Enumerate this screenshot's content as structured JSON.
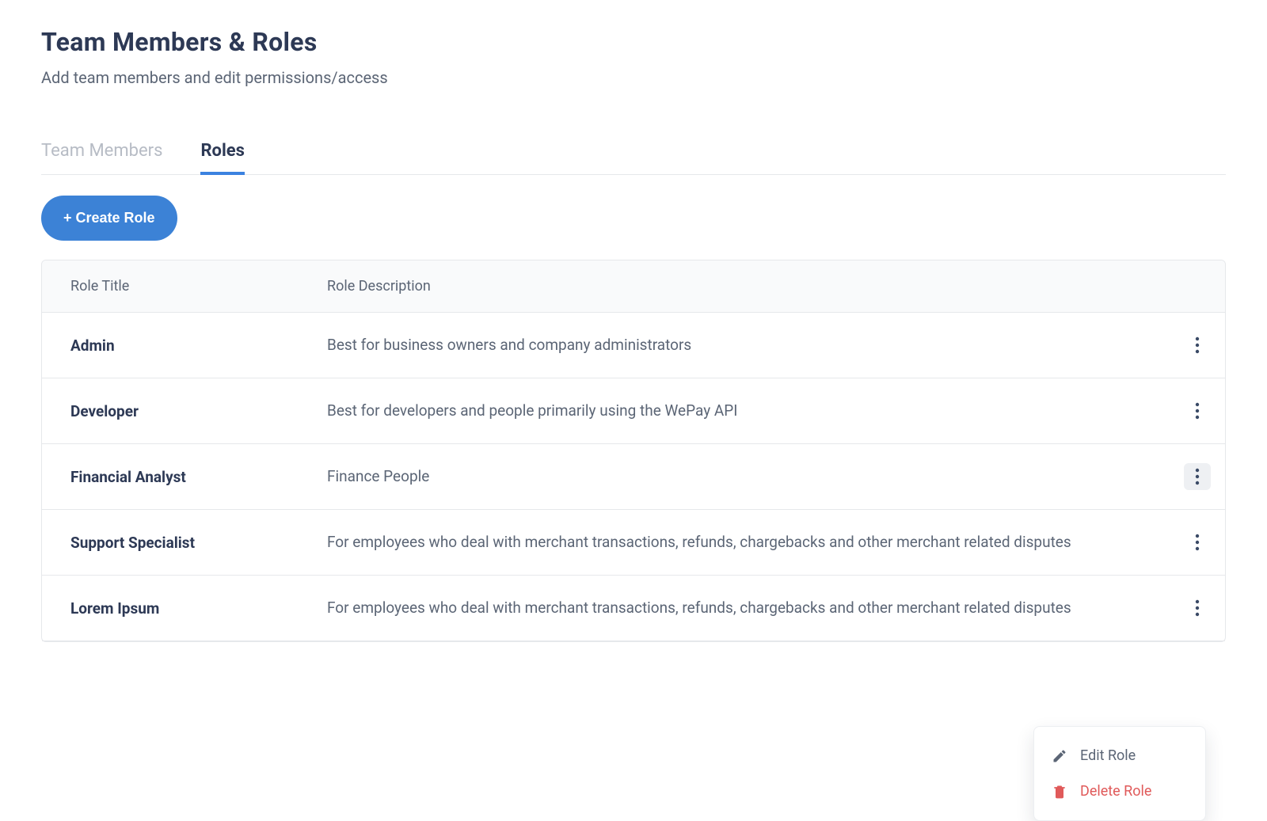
{
  "header": {
    "title": "Team Members & Roles",
    "subtitle": "Add team members and edit permissions/access"
  },
  "tabs": [
    {
      "label": "Team Members",
      "active": false
    },
    {
      "label": "Roles",
      "active": true
    }
  ],
  "actions": {
    "create_label": "+ Create Role"
  },
  "table": {
    "columns": {
      "title": "Role Title",
      "description": "Role Description"
    },
    "rows": [
      {
        "title": "Admin",
        "description": "Best for business owners and company administrators",
        "menu_open": false
      },
      {
        "title": "Developer",
        "description": "Best for developers and people primarily using the WePay API",
        "menu_open": false
      },
      {
        "title": "Financial Analyst",
        "description": "Finance People",
        "menu_open": true
      },
      {
        "title": "Support Specialist",
        "description": "For employees who deal with merchant transactions, refunds, chargebacks and other merchant related disputes",
        "menu_open": false
      },
      {
        "title": "Lorem Ipsum",
        "description": "For employees who deal with merchant transactions, refunds, chargebacks and other merchant related disputes",
        "menu_open": false
      }
    ]
  },
  "row_menu": {
    "edit_label": "Edit Role",
    "delete_label": "Delete Role"
  },
  "colors": {
    "accent": "#3c82d6",
    "danger": "#e05a5a",
    "text_primary": "#2d3955",
    "text_secondary": "#5b6575"
  }
}
